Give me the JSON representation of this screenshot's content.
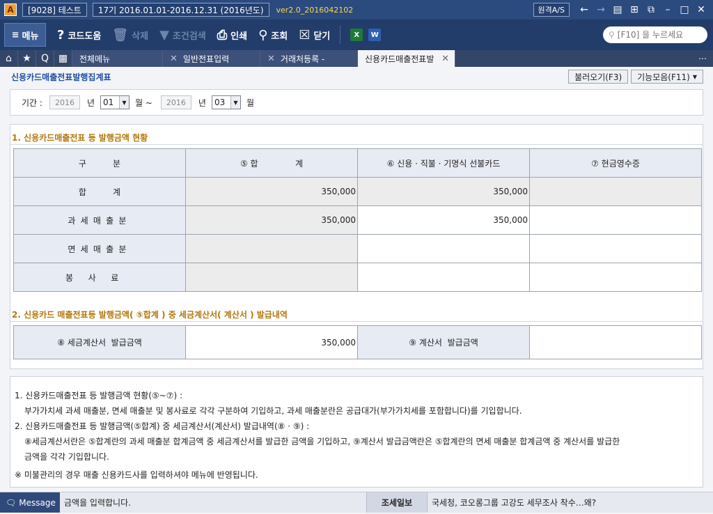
{
  "titlebar": {
    "app_icon": "A",
    "company": "[9028] 테스트",
    "period": "17기  2016.01.01-2016.12.31  (2016년도)",
    "version": "ver2.0_2016042102",
    "remote": "원격A/S",
    "icons": [
      "back-arrow-icon",
      "forward-arrow-icon",
      "book-icon",
      "grid-icon",
      "window-icon",
      "minimize-icon",
      "maximize-icon",
      "close-icon"
    ]
  },
  "toolbar": {
    "menu": "메뉴",
    "help": "코드도움",
    "delete": "삭제",
    "filter": "조건검색",
    "print": "인쇄",
    "search": "조회",
    "close": "닫기",
    "search_placeholder": "[F10] 을 누르세요"
  },
  "tabs": [
    {
      "label": "전체메뉴",
      "closable": false
    },
    {
      "label": "일반전표입력",
      "closable": true
    },
    {
      "label": "거래처등록 -",
      "closable": true
    },
    {
      "label": "신용카드매출전표발",
      "closable": true,
      "active": true
    }
  ],
  "page": {
    "title": "신용카드매출전표발행집계표",
    "btn_load": "불러오기(F3)",
    "btn_functions": "기능모음(F11)"
  },
  "period": {
    "label": "기간 :",
    "from_year": "2016",
    "from_month": "01",
    "to_year": "2016",
    "to_month": "03",
    "year_unit": "년",
    "month_unit_tilde": "월 ~",
    "month_unit": "월"
  },
  "section1": {
    "title": "1. 신용카드매출전표 등 발행금액 현황",
    "headers": [
      "구          분",
      "⑤ 합              계",
      "⑥ 신용 · 직불 · 기명식 선불카드",
      "⑦ 현금영수증"
    ],
    "rows": [
      {
        "label": "합          계",
        "total": "350,000",
        "card": "350,000",
        "cash": ""
      },
      {
        "label": "과세매출분",
        "total": "350,000",
        "card": "350,000",
        "cash": ""
      },
      {
        "label": "면세매출분",
        "total": "",
        "card": "",
        "cash": ""
      },
      {
        "label": "봉사료",
        "total": "",
        "card": "",
        "cash": ""
      }
    ]
  },
  "section2": {
    "title": "2. 신용카드 매출전표등 발행금액( ⑤합계  ) 중 세금계산서( 계산서  ) 발급내역",
    "tax_invoice_label": "⑧ 세금계산서  발급금액",
    "tax_invoice_value": "350,000",
    "invoice_label": "⑨ 계산서  발급금액",
    "invoice_value": ""
  },
  "notes": [
    "1. 신용카드매출전표  등  발행금액  현황(⑤~⑦) :",
    "부가가치세  과세  매출분, 면세  매출분  및  봉사료로  각각  구분하여  기입하고, 과세  매출분란은  공급대가(부가가치세를 포함합니다)를 기입합니다.",
    "2. 신용카드매출전표  등  발행금액(⑤합계)  중  세금계산서(계산서)  발급내역(⑧ · ⑨) :",
    "⑧세금계산서란은  ⑤합계란의  과세  매출분  합계금액  중  세금계산서를  발급한  금액을  기입하고, ⑨계산서  발급금액란은  ⑤합계란의  면세  매출분  합계금액  중  계산서를 발급한",
    "금액을  각각  기입합니다.",
    "※ 미불관리의 경우 매출 신용카드사를 입력하셔야 메뉴에 반영됩니다."
  ],
  "status": {
    "message_tab": "Message",
    "message_text": "금액을 입력합니다.",
    "news_label": "조세일보",
    "news_text": "국세청, 코오롱그룹 고강도 세무조사 착수…왜?"
  }
}
